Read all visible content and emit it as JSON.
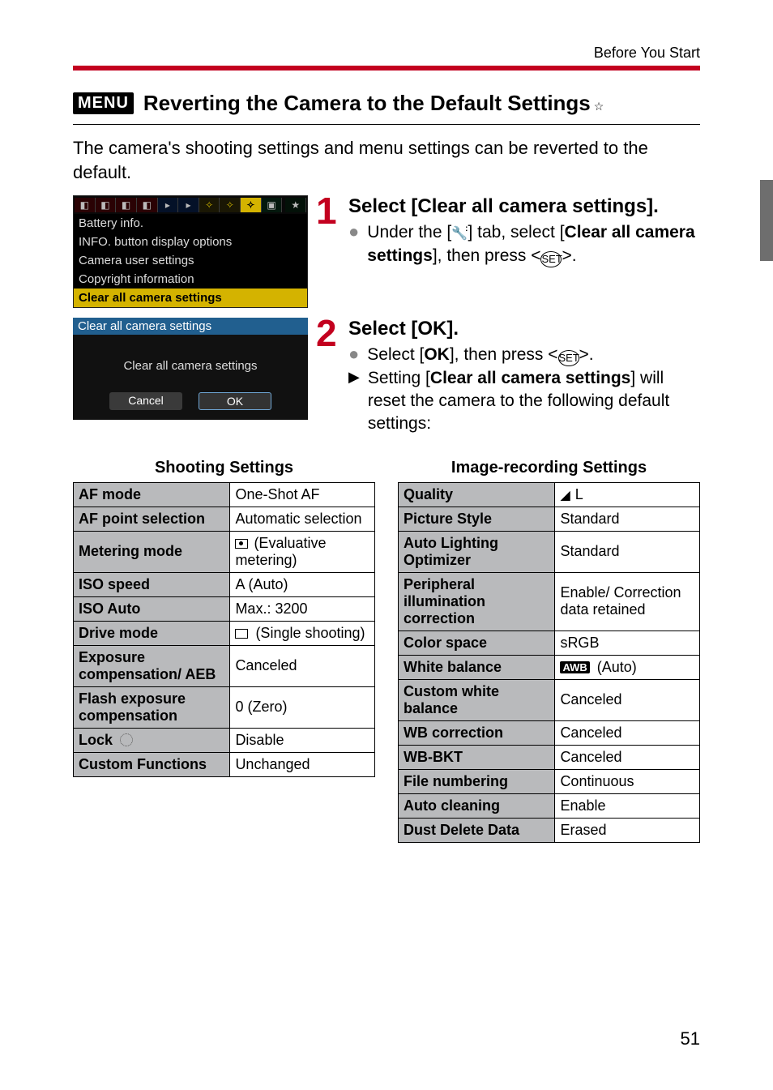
{
  "header": {
    "breadcrumb": "Before You Start"
  },
  "section": {
    "menu_badge": "MENU",
    "title": "Reverting the Camera to the Default Settings",
    "star": "☆"
  },
  "intro": "The camera's shooting settings and menu settings can be reverted to the default.",
  "menu_screen": {
    "items": [
      "Battery info.",
      "INFO. button display options",
      "Camera user settings",
      "Copyright information",
      "Clear all camera settings"
    ]
  },
  "panel2": {
    "header": "Clear all camera settings",
    "body": "Clear all camera settings",
    "cancel": "Cancel",
    "ok": "OK"
  },
  "steps": [
    {
      "num": "1",
      "title": "Select [Clear all camera settings].",
      "bullets": [
        {
          "type": "dot",
          "pre": "Under the [",
          "mid": "] tab, select [",
          "strong": "Clear all camera settings",
          "post": "], then press <",
          "end": ">."
        }
      ]
    },
    {
      "num": "2",
      "title": "Select [OK].",
      "bullets": [
        {
          "type": "dot",
          "pre": "Select [",
          "strong": "OK",
          "mid2": "], then press <",
          "end": ">."
        },
        {
          "type": "tri",
          "pre": "Setting [",
          "strong": "Clear all camera settings",
          "post": "] will reset the camera to the following default settings:"
        }
      ]
    }
  ],
  "shooting": {
    "title": "Shooting Settings",
    "rows": [
      [
        "AF mode",
        "One-Shot AF"
      ],
      [
        "AF point selection",
        "Automatic selection"
      ],
      [
        "Metering mode",
        " (Evaluative metering)"
      ],
      [
        "ISO speed",
        "A (Auto)"
      ],
      [
        "ISO Auto",
        "Max.: 3200"
      ],
      [
        "Drive mode",
        " (Single shooting)"
      ],
      [
        "Exposure compensation/ AEB",
        "Canceled"
      ],
      [
        "Flash exposure compensation",
        "0 (Zero)"
      ],
      [
        "Lock ",
        "Disable"
      ],
      [
        "Custom Functions",
        "Unchanged"
      ]
    ]
  },
  "image": {
    "title": "Image-recording Settings",
    "rows": [
      [
        "Quality",
        " L"
      ],
      [
        "Picture Style",
        "Standard"
      ],
      [
        "Auto Lighting Optimizer",
        "Standard"
      ],
      [
        "Peripheral illumination correction",
        "Enable/ Correction data retained"
      ],
      [
        "Color space",
        "sRGB"
      ],
      [
        "White balance",
        " (Auto)"
      ],
      [
        "Custom white balance",
        "Canceled"
      ],
      [
        "WB correction",
        "Canceled"
      ],
      [
        "WB-BKT",
        "Canceled"
      ],
      [
        "File numbering",
        "Continuous"
      ],
      [
        "Auto cleaning",
        "Enable"
      ],
      [
        "Dust Delete Data",
        "Erased"
      ]
    ]
  },
  "page": "51"
}
